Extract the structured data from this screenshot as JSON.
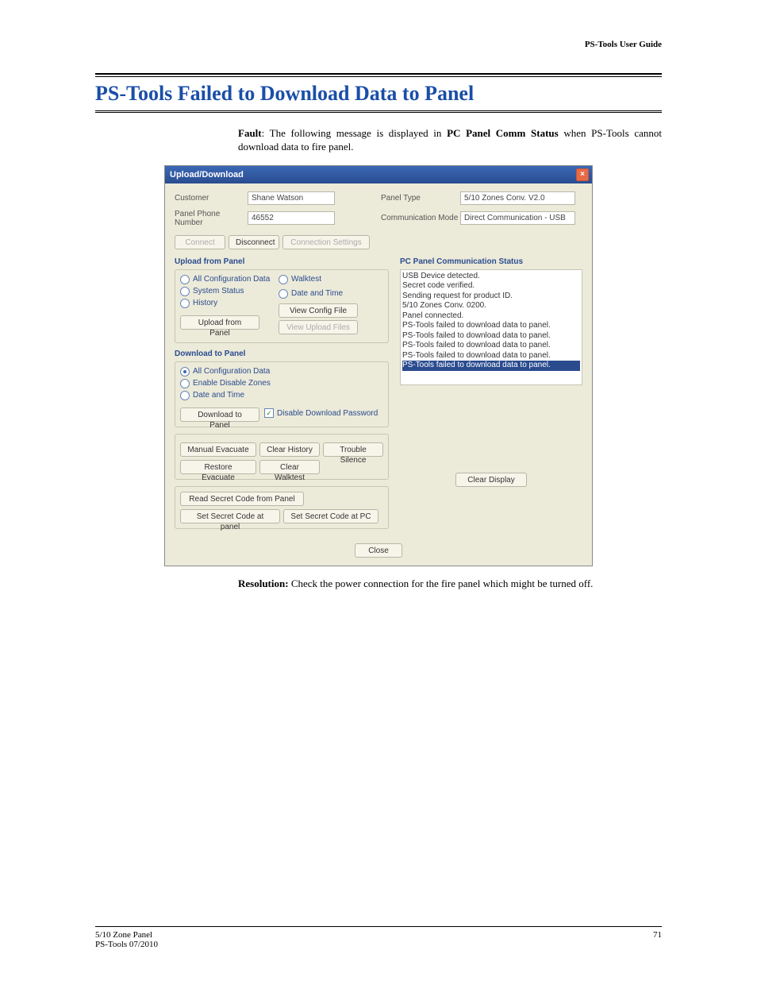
{
  "doc": {
    "running_header": "PS-Tools User Guide",
    "section_title": "PS-Tools Failed to Download Data to Panel",
    "fault_label": "Fault",
    "fault_text": ": The following message is displayed in ",
    "fault_bold": "PC Panel Comm Status",
    "fault_tail": " when PS-Tools cannot download data to fire panel.",
    "resolution_label": "Resolution:",
    "resolution_text": " Check the power connection for the fire panel which might be turned off.",
    "footer_left1": "5/10 Zone Panel",
    "footer_left2": "PS-Tools 07/2010",
    "footer_page": "71"
  },
  "dialog": {
    "title": "Upload/Download",
    "customer_label": "Customer",
    "customer_value": "Shane Watson",
    "phone_label": "Panel Phone Number",
    "phone_value": "46552",
    "panel_type_label": "Panel Type",
    "panel_type_value": "5/10 Zones Conv. V2.0",
    "comm_mode_label": "Communication Mode",
    "comm_mode_value": "Direct Communication - USB",
    "connect_btn": "Connect",
    "disconnect_btn": "Disconnect",
    "conn_settings_btn": "Connection Settings",
    "upload_header": "Upload from Panel",
    "upload_opts": {
      "all_config": "All Configuration Data",
      "system_status": "System Status",
      "history": "History",
      "walktest": "Walktest",
      "date_time": "Date and Time"
    },
    "view_config_btn": "View Config File",
    "upload_btn": "Upload from Panel",
    "view_upload_btn": "View Upload Files",
    "download_header": "Download to Panel",
    "download_opts": {
      "all_config": "All Configuration Data",
      "enable_disable": "Enable Disable Zones",
      "date_time": "Date and Time"
    },
    "download_btn": "Download to Panel",
    "disable_pwd_label": "Disable Download Password",
    "manual_evac": "Manual Evacuate",
    "clear_history": "Clear History",
    "trouble_silence": "Trouble Silence",
    "restore_evac": "Restore Evacuate",
    "clear_walktest": "Clear Walktest",
    "read_secret": "Read Secret Code from Panel",
    "set_secret_panel": "Set Secret Code at panel",
    "set_secret_pc": "Set Secret Code at PC",
    "comm_status_header": "PC Panel Communication Status",
    "status_lines": [
      "USB Device detected.",
      "Secret code verified.",
      "Sending request for product ID.",
      "5/10 Zones Conv. 0200.",
      "Panel connected.",
      "PS-Tools failed to download data to panel.",
      "PS-Tools failed to download data to panel.",
      "PS-Tools failed to download data to panel.",
      "PS-Tools failed to download data to panel."
    ],
    "status_selected": "PS-Tools failed to download data to panel.",
    "clear_display_btn": "Clear Display",
    "close_btn": "Close"
  }
}
